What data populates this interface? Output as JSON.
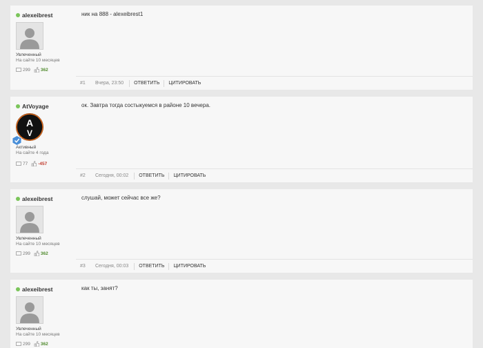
{
  "posts": [
    {
      "author": "alexeibrest",
      "rank": "Увлеченный",
      "since": "На сайте 10 месяцев",
      "posts_count": "299",
      "reputation": "362",
      "message": "ник на 888 - alexeibrest1",
      "number": "#1",
      "date": "Вчера, 23:50",
      "reply": "ОТВЕТИТЬ",
      "quote": "ЦИТИРОВАТЬ"
    },
    {
      "author": "AtVoyage",
      "rank": "Активный",
      "since": "На сайте 4 года",
      "posts_count": "77",
      "reputation": "-457",
      "message": "ок. Завтра тогда состыкуемся в районе 10 вечера.",
      "number": "#2",
      "date": "Сегодня, 00:02",
      "reply": "ОТВЕТИТЬ",
      "quote": "ЦИТИРОВАТЬ",
      "avatar_letters": "AV"
    },
    {
      "author": "alexeibrest",
      "rank": "Увлеченный",
      "since": "На сайте 10 месяцев",
      "posts_count": "299",
      "reputation": "362",
      "message": "слушай, может сейчас все же?",
      "number": "#3",
      "date": "Сегодня, 00:03",
      "reply": "ОТВЕТИТЬ",
      "quote": "ЦИТИРОВАТЬ"
    },
    {
      "author": "alexeibrest",
      "rank": "Увлеченный",
      "since": "На сайте 10 месяцев",
      "posts_count": "299",
      "reputation": "362",
      "message": "как ты, занят?"
    }
  ],
  "colors": {
    "online": "#7bc55a",
    "rep_positive": "#4f8a2c",
    "rep_negative": "#c0392b"
  }
}
